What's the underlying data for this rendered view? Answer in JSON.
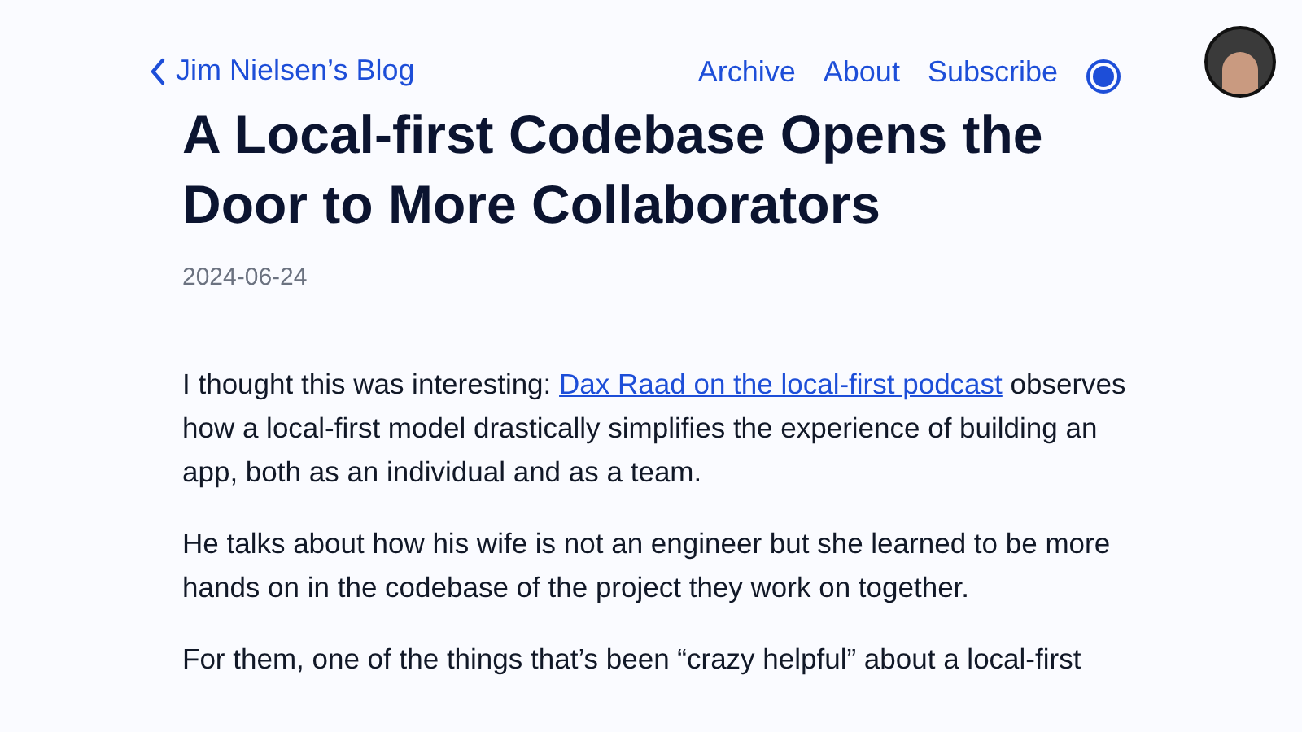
{
  "header": {
    "back_link": "Jim Nielsen’s Blog",
    "nav": [
      "Archive",
      "About",
      "Subscribe"
    ]
  },
  "article": {
    "title": "A Local-first Codebase Opens the Door to More Collaborators",
    "date": "2024-06-24",
    "paragraphs": [
      {
        "before": "I thought this was interesting: ",
        "link": "Dax Raad on the local-first podcast",
        "after": " observes how a local-first model drastically simplifies the experience of building an app, both as an individual and as a team."
      },
      {
        "before": "He talks about how his wife is not an engineer but she learned to be more hands on in the codebase of the project they work on together."
      },
      {
        "before": "For them, one of the things that’s been “crazy helpful” about a local-first"
      }
    ]
  }
}
